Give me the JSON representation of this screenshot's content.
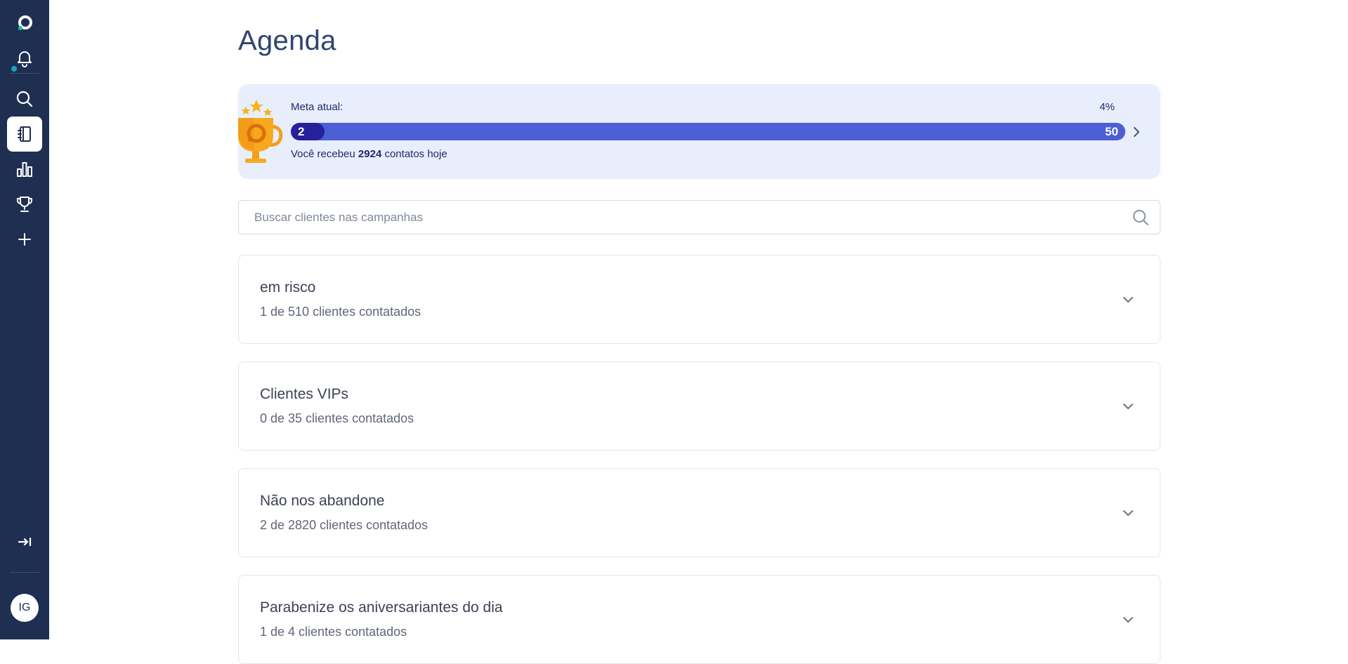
{
  "sidebar": {
    "items": [
      {
        "name": "logo-icon"
      },
      {
        "name": "bell-icon"
      },
      {
        "name": "search-icon"
      },
      {
        "name": "agenda-book-icon",
        "active": true
      },
      {
        "name": "bar-chart-icon"
      },
      {
        "name": "trophy-icon"
      },
      {
        "name": "plus-icon"
      }
    ],
    "collapse_icon": "collapse-arrow-icon",
    "avatar_initials": "IG"
  },
  "page": {
    "title": "Agenda"
  },
  "goal": {
    "label": "Meta atual:",
    "percent_label": "4%",
    "current": "2",
    "target": "50",
    "progress_fraction": 0.04,
    "received_prefix": "Você recebeu",
    "received_count": "2924",
    "received_suffix": "contatos hoje"
  },
  "search": {
    "placeholder": "Buscar clientes nas campanhas"
  },
  "campaigns": [
    {
      "name": "em risco",
      "progress": "1 de 510 clientes contatados"
    },
    {
      "name": "Clientes VIPs",
      "progress": "0 de 35 clientes contatados"
    },
    {
      "name": "Não nos abandone",
      "progress": "2 de 2820 clientes contatados"
    },
    {
      "name": "Parabenize os aniversariantes do dia",
      "progress": "1 de 4 clientes contatados"
    }
  ],
  "colors": {
    "sidebar_bg": "#1e2f52",
    "title": "#2f4570",
    "goal_bg": "#e8eefc",
    "progress_track": "#4c5fd5",
    "progress_fill": "#26209a"
  }
}
